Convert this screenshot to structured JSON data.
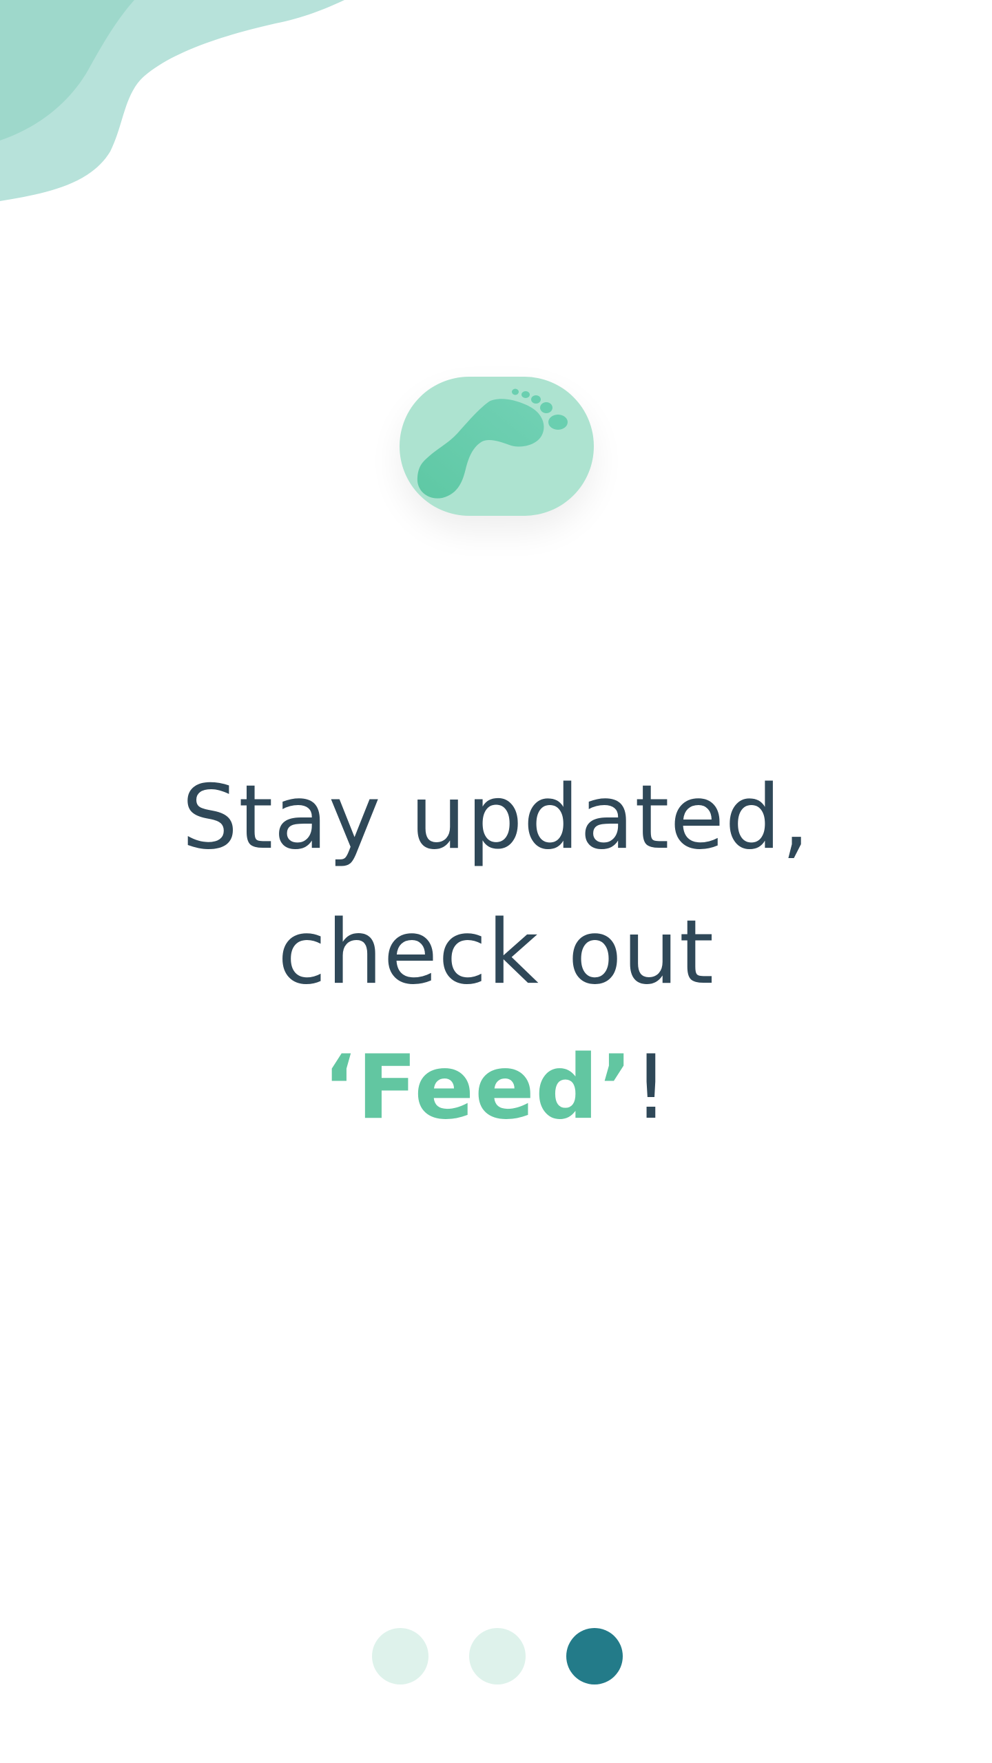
{
  "onboarding": {
    "headline": {
      "line1": "Stay updated,",
      "line2": "check out",
      "line3_highlight": "‘Feed’",
      "line3_suffix": "!"
    },
    "logo_icon": "footprint-icon",
    "pager": {
      "total": 3,
      "current": 3
    }
  },
  "colors": {
    "text_dark": "#2f4858",
    "accent_green": "#62c6a1",
    "badge_bg": "#ade3d0",
    "blob_light": "#b7e2da",
    "blob_dark": "#9ed8cb",
    "dot_inactive": "#def2eb",
    "dot_active": "#237b89"
  }
}
